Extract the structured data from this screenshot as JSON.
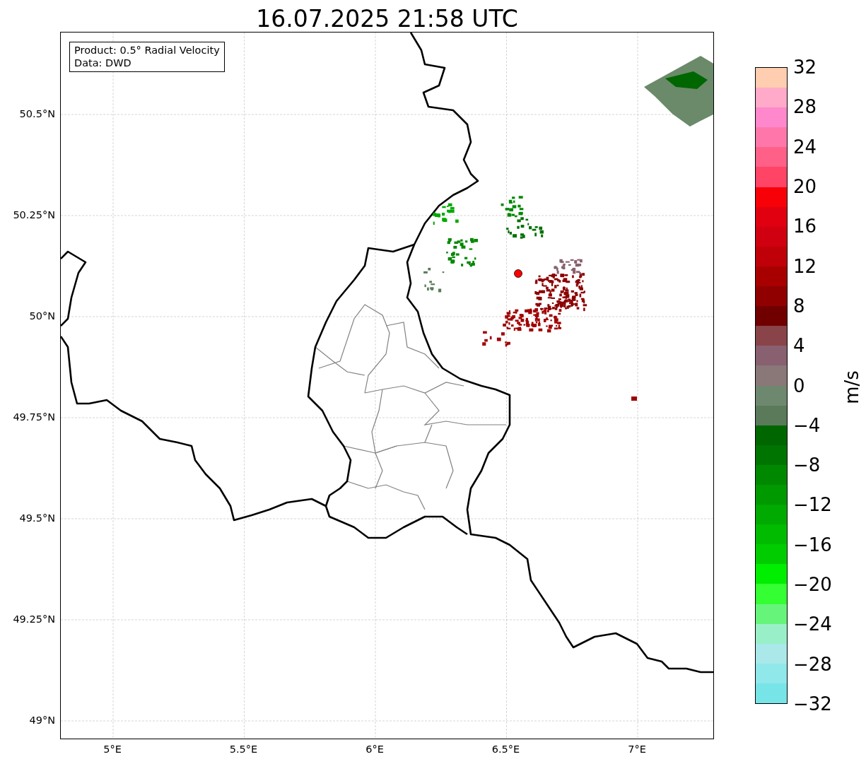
{
  "title": "16.07.2025 21:58 UTC",
  "legend": [
    "Product: 0.5° Radial Velocity",
    "Data: DWD"
  ],
  "map": {
    "lat_ticks": [
      "50.5°N",
      "50.25°N",
      "50°N",
      "49.75°N",
      "49.5°N",
      "49.25°N",
      "49°N"
    ],
    "lon_ticks": [
      "5°E",
      "5.5°E",
      "6°E",
      "6.5°E",
      "7°E"
    ]
  },
  "colorbar": {
    "label": "m/s",
    "ticks": [
      "32",
      "28",
      "24",
      "20",
      "16",
      "12",
      "8",
      "4",
      "0",
      "−4",
      "−8",
      "−12",
      "−16",
      "−20",
      "−24",
      "−28",
      "−32"
    ],
    "segments": [
      {
        "color": "#ffcdb0"
      },
      {
        "color": "#ffaac8"
      },
      {
        "color": "#ff88cc"
      },
      {
        "color": "#ff77aa"
      },
      {
        "color": "#ff6088"
      },
      {
        "color": "#ff4466"
      },
      {
        "color": "#f80008"
      },
      {
        "color": "#e00010"
      },
      {
        "color": "#d00010"
      },
      {
        "color": "#c00008"
      },
      {
        "color": "#a80000"
      },
      {
        "color": "#900000"
      },
      {
        "color": "#700000"
      },
      {
        "color": "#884448"
      },
      {
        "color": "#886070"
      },
      {
        "color": "#8a7878"
      },
      {
        "color": "#6e8870"
      },
      {
        "color": "#5a7a5a"
      },
      {
        "color": "#006600"
      },
      {
        "color": "#007400"
      },
      {
        "color": "#008800"
      },
      {
        "color": "#009900"
      },
      {
        "color": "#00aa00"
      },
      {
        "color": "#00bb00"
      },
      {
        "color": "#00cc00"
      },
      {
        "color": "#00ee00"
      },
      {
        "color": "#33ff33"
      },
      {
        "color": "#66f57a"
      },
      {
        "color": "#99f0c8"
      },
      {
        "color": "#aae8ea"
      },
      {
        "color": "#90e8ea"
      },
      {
        "color": "#77e4e8"
      }
    ]
  }
}
